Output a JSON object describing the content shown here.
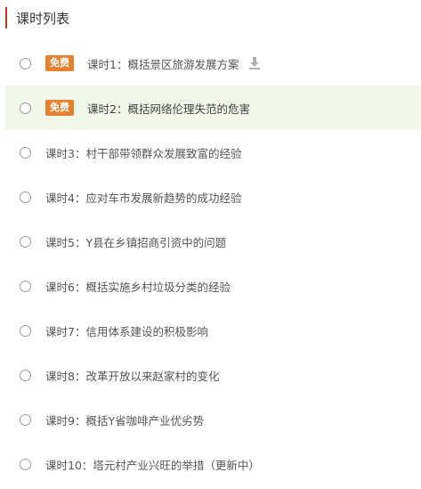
{
  "header": {
    "title": "课时列表"
  },
  "lessons": [
    {
      "title": "课时1：概括景区旅游发展方案",
      "badge": "免费",
      "download": true
    },
    {
      "title": "课时2：概括网络伦理失范的危害",
      "badge": "免费",
      "active": true
    },
    {
      "title": "课时3：村干部带领群众发展致富的经验"
    },
    {
      "title": "课时4：应对车市发展新趋势的成功经验"
    },
    {
      "title": "课时5：Y县在乡镇招商引资中的问题"
    },
    {
      "title": "课时6：概括实施乡村垃圾分类的经验"
    },
    {
      "title": "课时7：信用体系建设的积极影响"
    },
    {
      "title": "课时8：改革开放以来赵家村的变化"
    },
    {
      "title": "课时9：概括Y省咖啡产业优劣势"
    },
    {
      "title": "课时10：塔元村产业兴旺的举措（更新中）"
    }
  ],
  "colors": {
    "accent": "#c9302c",
    "badge": "#e8812e",
    "active_bg": "#f2f9ea"
  }
}
